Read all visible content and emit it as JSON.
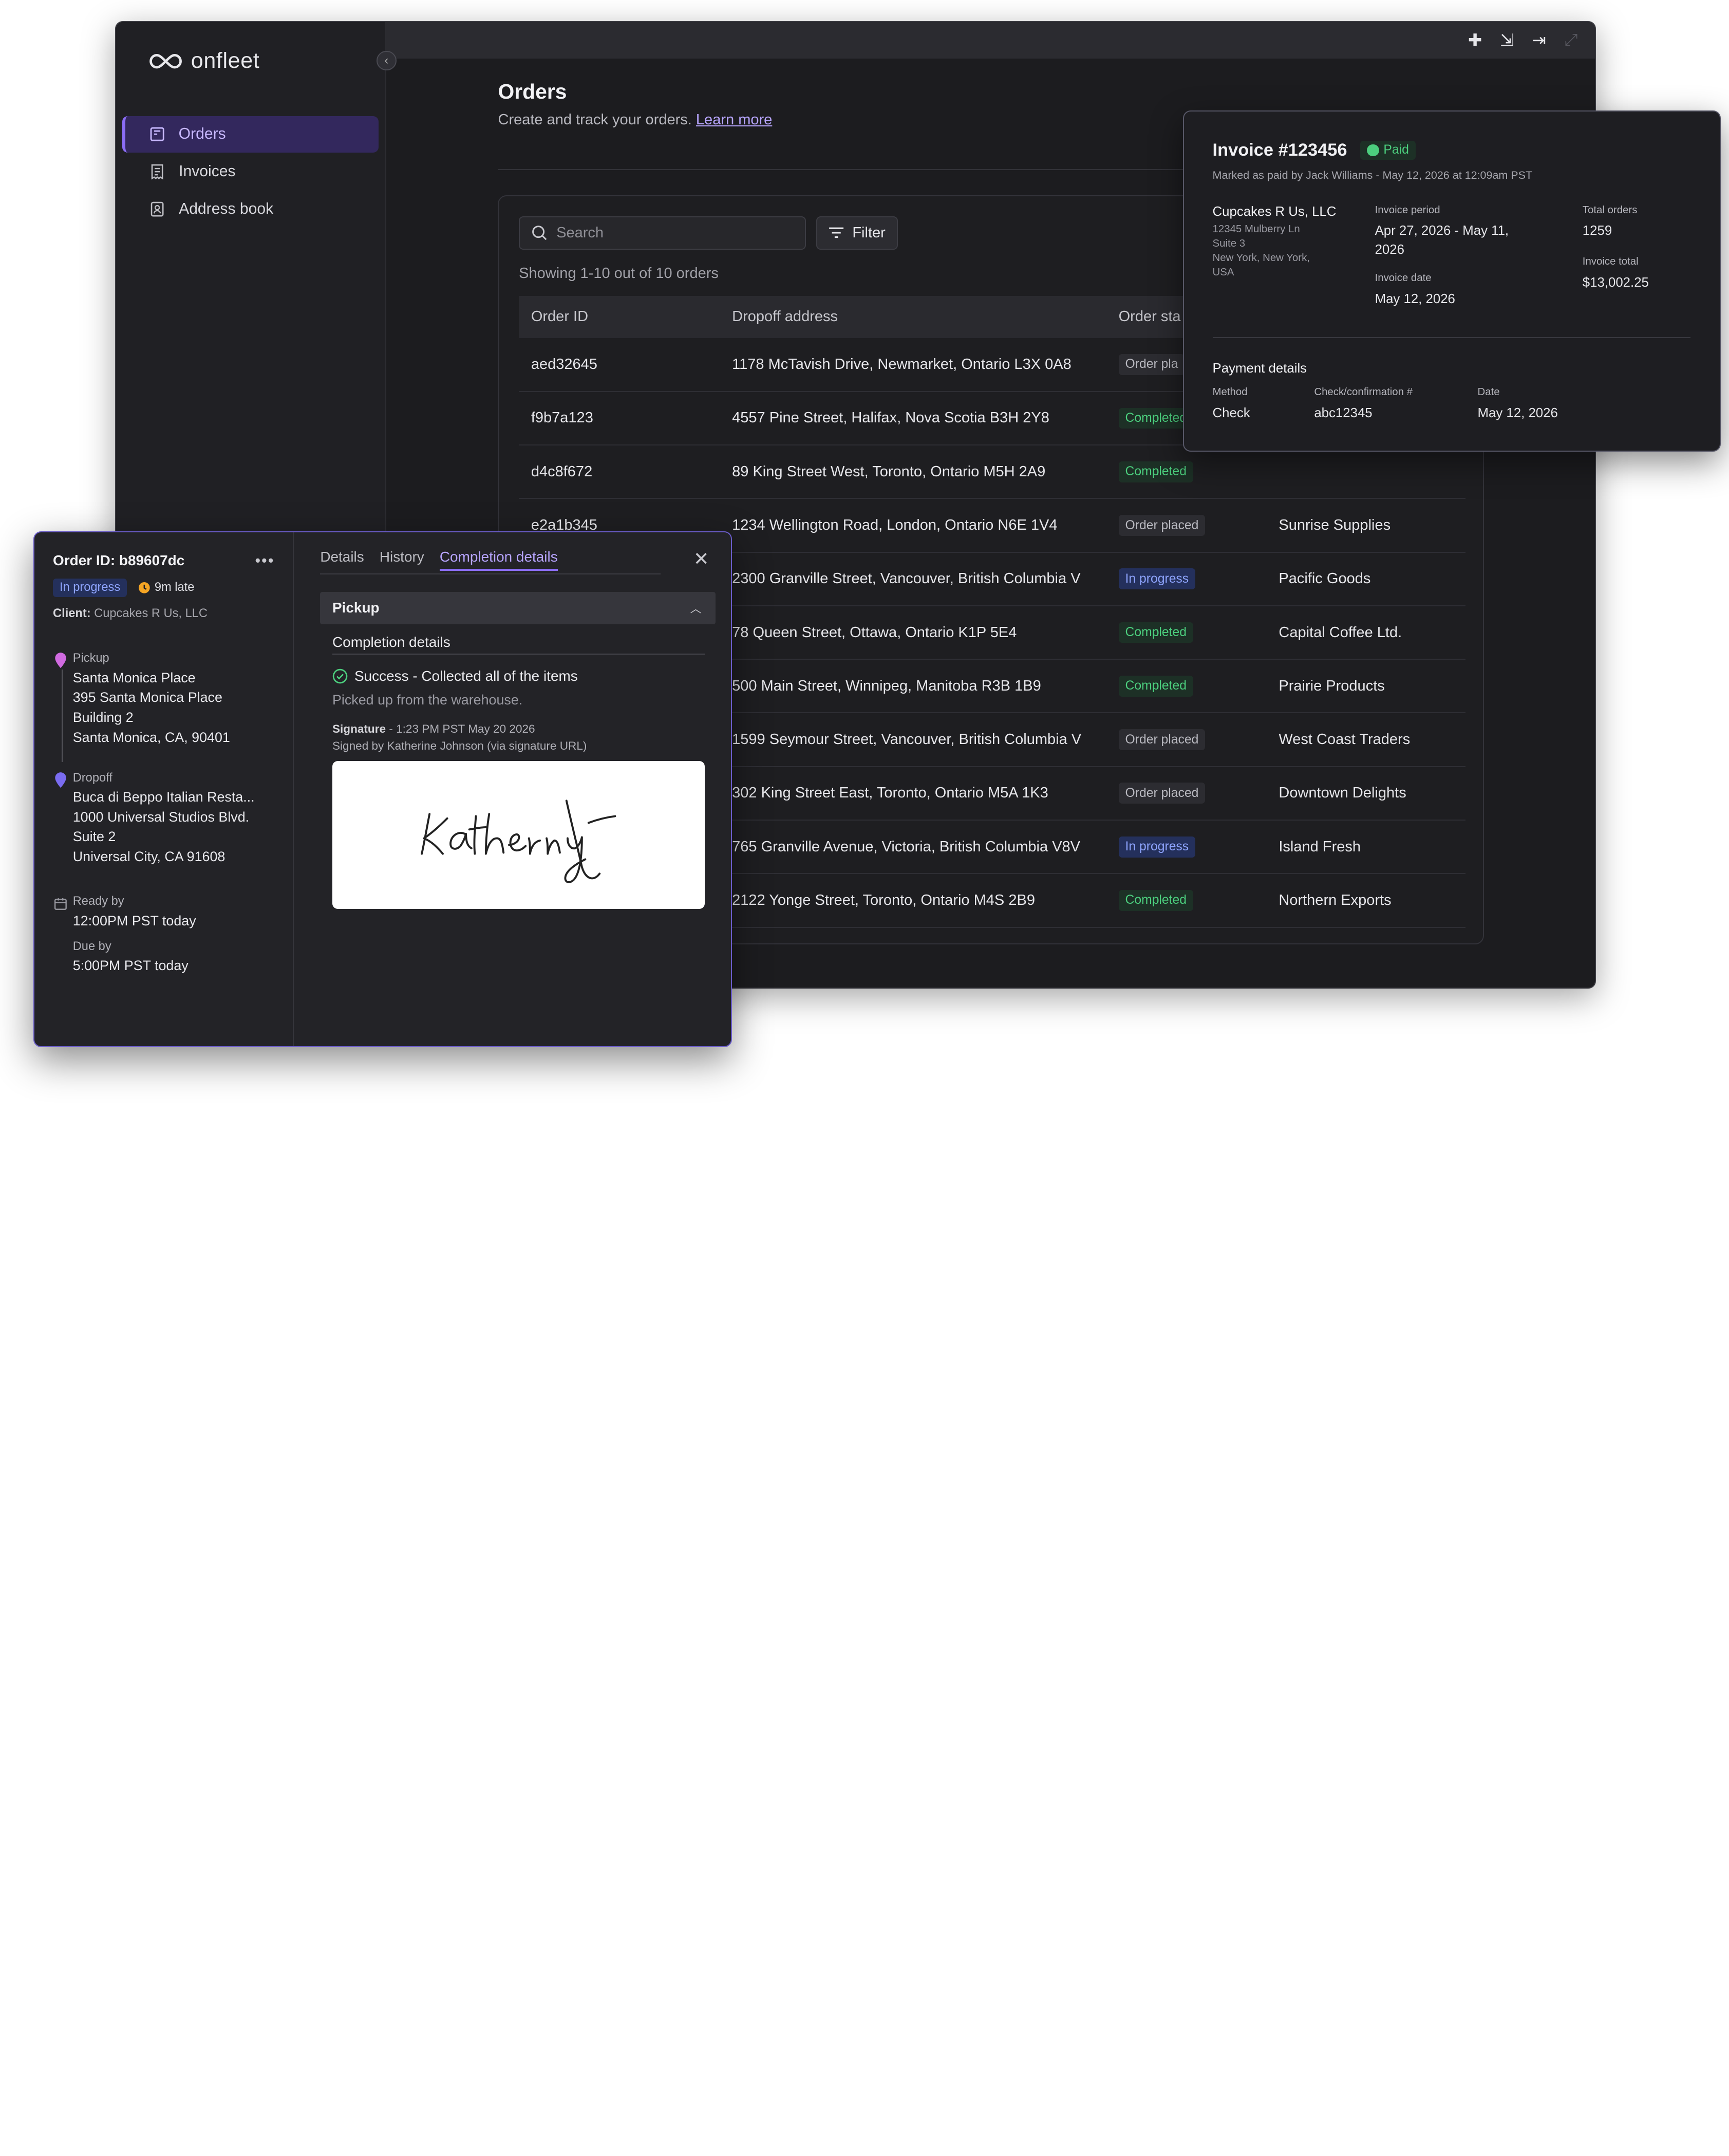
{
  "app": {
    "brand": "onfleet",
    "nav": [
      {
        "label": "Orders",
        "icon": "orders-icon",
        "active": true
      },
      {
        "label": "Invoices",
        "icon": "invoice-icon",
        "active": false
      },
      {
        "label": "Address book",
        "icon": "address-book-icon",
        "active": false
      }
    ],
    "topbar_icons": [
      "plus-icon",
      "import-icon",
      "export-icon",
      "expand-icon"
    ]
  },
  "orders": {
    "title": "Orders",
    "subtitle": "Create and track your orders.",
    "learn_more": "Learn more",
    "search_placeholder": "Search",
    "filter_label": "Filter",
    "showing": "Showing 1-10 out of 10 orders",
    "columns": [
      "Order ID",
      "Dropoff address",
      "Order sta"
    ],
    "rows": [
      {
        "id": "aed32645",
        "address": "1178 McTavish Drive, Newmarket, Ontario L3X 0A8",
        "status": "Order pla",
        "status_type": "placed",
        "client": ""
      },
      {
        "id": "f9b7a123",
        "address": "4557 Pine Street, Halifax, Nova Scotia B3H 2Y8",
        "status": "Completed",
        "status_type": "completed",
        "client": ""
      },
      {
        "id": "d4c8f672",
        "address": "89 King Street West, Toronto, Ontario M5H 2A9",
        "status": "Completed",
        "status_type": "completed",
        "client": ""
      },
      {
        "id": "e2a1b345",
        "address": "1234 Wellington Road, London, Ontario N6E 1V4",
        "status": "Order placed",
        "status_type": "placed",
        "client": "Sunrise Supplies"
      },
      {
        "id": "",
        "address": "2300 Granville Street, Vancouver, British Columbia V",
        "status": "In progress",
        "status_type": "progress",
        "client": "Pacific Goods"
      },
      {
        "id": "",
        "address": "78 Queen Street, Ottawa, Ontario K1P 5E4",
        "status": "Completed",
        "status_type": "completed",
        "client": "Capital Coffee Ltd."
      },
      {
        "id": "",
        "address": "500 Main Street, Winnipeg, Manitoba R3B 1B9",
        "status": "Completed",
        "status_type": "completed",
        "client": "Prairie Products"
      },
      {
        "id": "",
        "address": "1599 Seymour Street, Vancouver, British Columbia V",
        "status": "Order placed",
        "status_type": "placed",
        "client": "West Coast Traders"
      },
      {
        "id": "",
        "address": "302 King Street East, Toronto, Ontario M5A 1K3",
        "status": "Order placed",
        "status_type": "placed",
        "client": "Downtown Delights"
      },
      {
        "id": "",
        "address": "765 Granville Avenue, Victoria, British Columbia V8V",
        "status": "In progress",
        "status_type": "progress",
        "client": "Island Fresh"
      },
      {
        "id": "",
        "address": "2122 Yonge Street, Toronto, Ontario M4S 2B9",
        "status": "Completed",
        "status_type": "completed",
        "client": "Northern Exports"
      }
    ]
  },
  "invoice": {
    "title": "Invoice #123456",
    "status": "Paid",
    "marked": "Marked as paid by Jack Williams - May 12, 2026 at 12:09am PST",
    "client_name": "Cupcakes R Us, LLC",
    "address_lines": [
      "12345 Mulberry Ln",
      "Suite 3",
      "New York, New York,",
      "USA"
    ],
    "period_label": "Invoice period",
    "period_value": "Apr 27, 2026 - May 11, 2026",
    "date_label": "Invoice date",
    "date_value": "May 12, 2026",
    "total_orders_label": "Total orders",
    "total_orders_value": "1259",
    "total_label": "Invoice total",
    "total_value": "$13,002.25",
    "payment_title": "Payment details",
    "method_label": "Method",
    "method_value": "Check",
    "check_label": "Check/confirmation #",
    "check_value": "abc12345",
    "pdate_label": "Date",
    "pdate_value": "May 12, 2026"
  },
  "order_detail": {
    "id": "Order ID: b89607dc",
    "status": "In progress",
    "late": "9m late",
    "client_label": "Client:",
    "client_value": "Cupcakes R Us, LLC",
    "pickup_label": "Pickup",
    "pickup_lines": [
      "Santa Monica Place",
      "395 Santa Monica Place",
      "Building 2",
      "Santa Monica, CA, 90401"
    ],
    "dropoff_label": "Dropoff",
    "dropoff_lines": [
      "Buca di Beppo Italian Resta...",
      "1000 Universal Studios Blvd.",
      "Suite 2",
      "Universal City, CA 91608"
    ],
    "ready_label": "Ready by",
    "ready_value": "12:00PM PST today",
    "due_label": "Due by",
    "due_value": "5:00PM PST today",
    "tabs": [
      "Details",
      "History",
      "Completion details"
    ],
    "section": "Pickup",
    "completion_title": "Completion details",
    "success_text": "Success - Collected all of the items",
    "note": "Picked up from the warehouse.",
    "signature_label": "Signature",
    "signature_time": " - 1:23 PM PST May 20 2026",
    "signed_by": "Signed by Katherine Johnson (via signature URL)"
  },
  "colors": {
    "accent": "#8b6df5",
    "success": "#4ccf7e",
    "progress": "#8fa5ff"
  }
}
